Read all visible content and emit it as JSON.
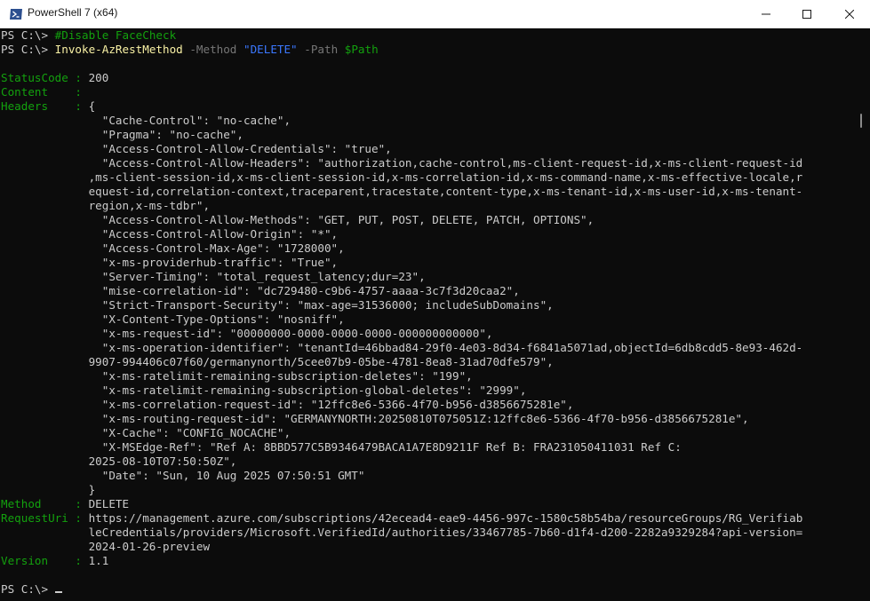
{
  "window": {
    "title": "PowerShell 7 (x64)",
    "icon": "powershell-icon",
    "controls": {
      "minimize": "minimize-icon",
      "maximize": "maximize-icon",
      "close": "close-icon"
    }
  },
  "colors": {
    "background": "#0c0c0c",
    "default_text": "#cccccc",
    "property_green": "#13a10e",
    "command_yellow": "#f9f1a5",
    "parameter_gray": "#767676",
    "string_blue": "#3b78ff"
  },
  "terminal": {
    "lines": [
      [
        {
          "t": "PS C:\\> ",
          "c": "c-def"
        },
        {
          "t": "#Disable FaceCheck",
          "c": "c-cmt"
        }
      ],
      [
        {
          "t": "PS C:\\> ",
          "c": "c-def"
        },
        {
          "t": "Invoke-AzRestMethod",
          "c": "c-cmd"
        },
        {
          "t": " -Method ",
          "c": "c-par"
        },
        {
          "t": "\"DELETE\"",
          "c": "c-str"
        },
        {
          "t": " -Path ",
          "c": "c-par"
        },
        {
          "t": "$Path",
          "c": "c-var"
        }
      ],
      [],
      [
        {
          "t": "StatusCode : ",
          "c": "c-grn"
        },
        {
          "t": "200",
          "c": "c-def"
        }
      ],
      [
        {
          "t": "Content    : ",
          "c": "c-grn"
        }
      ],
      [
        {
          "t": "Headers    : ",
          "c": "c-grn"
        },
        {
          "t": "{",
          "c": "c-def"
        }
      ],
      [
        {
          "t": "               \"Cache-Control\": \"no-cache\",",
          "c": "c-def"
        }
      ],
      [
        {
          "t": "               \"Pragma\": \"no-cache\",",
          "c": "c-def"
        }
      ],
      [
        {
          "t": "               \"Access-Control-Allow-Credentials\": \"true\",",
          "c": "c-def"
        }
      ],
      [
        {
          "t": "               \"Access-Control-Allow-Headers\": \"authorization,cache-control,ms-client-request-id,x-ms-client-request-id",
          "c": "c-def"
        }
      ],
      [
        {
          "t": "             ,ms-client-session-id,x-ms-client-session-id,x-ms-correlation-id,x-ms-command-name,x-ms-effective-locale,r",
          "c": "c-def"
        }
      ],
      [
        {
          "t": "             equest-id,correlation-context,traceparent,tracestate,content-type,x-ms-tenant-id,x-ms-user-id,x-ms-tenant-",
          "c": "c-def"
        }
      ],
      [
        {
          "t": "             region,x-ms-tdbr\",",
          "c": "c-def"
        }
      ],
      [
        {
          "t": "               \"Access-Control-Allow-Methods\": \"GET, PUT, POST, DELETE, PATCH, OPTIONS\",",
          "c": "c-def"
        }
      ],
      [
        {
          "t": "               \"Access-Control-Allow-Origin\": \"*\",",
          "c": "c-def"
        }
      ],
      [
        {
          "t": "               \"Access-Control-Max-Age\": \"1728000\",",
          "c": "c-def"
        }
      ],
      [
        {
          "t": "               \"x-ms-providerhub-traffic\": \"True\",",
          "c": "c-def"
        }
      ],
      [
        {
          "t": "               \"Server-Timing\": \"total_request_latency;dur=23\",",
          "c": "c-def"
        }
      ],
      [
        {
          "t": "               \"mise-correlation-id\": \"dc729480-c9b6-4757-aaaa-3c7f3d20caa2\",",
          "c": "c-def"
        }
      ],
      [
        {
          "t": "               \"Strict-Transport-Security\": \"max-age=31536000; includeSubDomains\",",
          "c": "c-def"
        }
      ],
      [
        {
          "t": "               \"X-Content-Type-Options\": \"nosniff\",",
          "c": "c-def"
        }
      ],
      [
        {
          "t": "               \"x-ms-request-id\": \"00000000-0000-0000-0000-000000000000\",",
          "c": "c-def"
        }
      ],
      [
        {
          "t": "               \"x-ms-operation-identifier\": \"tenantId=46bbad84-29f0-4e03-8d34-f6841a5071ad,objectId=6db8cdd5-8e93-462d-",
          "c": "c-def"
        }
      ],
      [
        {
          "t": "             9907-994406c07f60/germanynorth/5cee07b9-05be-4781-8ea8-31ad70dfe579\",",
          "c": "c-def"
        }
      ],
      [
        {
          "t": "               \"x-ms-ratelimit-remaining-subscription-deletes\": \"199\",",
          "c": "c-def"
        }
      ],
      [
        {
          "t": "               \"x-ms-ratelimit-remaining-subscription-global-deletes\": \"2999\",",
          "c": "c-def"
        }
      ],
      [
        {
          "t": "               \"x-ms-correlation-request-id\": \"12ffc8e6-5366-4f70-b956-d3856675281e\",",
          "c": "c-def"
        }
      ],
      [
        {
          "t": "               \"x-ms-routing-request-id\": \"GERMANYNORTH:20250810T075051Z:12ffc8e6-5366-4f70-b956-d3856675281e\",",
          "c": "c-def"
        }
      ],
      [
        {
          "t": "               \"X-Cache\": \"CONFIG_NOCACHE\",",
          "c": "c-def"
        }
      ],
      [
        {
          "t": "               \"X-MSEdge-Ref\": \"Ref A: 8BBD577C5B9346479BACA1A7E8D9211F Ref B: FRA231050411031 Ref C:",
          "c": "c-def"
        }
      ],
      [
        {
          "t": "             2025-08-10T07:50:50Z\",",
          "c": "c-def"
        }
      ],
      [
        {
          "t": "               \"Date\": \"Sun, 10 Aug 2025 07:50:51 GMT\"",
          "c": "c-def"
        }
      ],
      [
        {
          "t": "             }",
          "c": "c-def"
        }
      ],
      [
        {
          "t": "Method     : ",
          "c": "c-grn"
        },
        {
          "t": "DELETE",
          "c": "c-def"
        }
      ],
      [
        {
          "t": "RequestUri : ",
          "c": "c-grn"
        },
        {
          "t": "https://management.azure.com/subscriptions/42ecead4-eae9-4456-997c-1580c58b54ba/resourceGroups/RG_Verifiab",
          "c": "c-def"
        }
      ],
      [
        {
          "t": "             leCredentials/providers/Microsoft.VerifiedId/authorities/33467785-7b60-d1f4-d200-2282a9329284?api-version=",
          "c": "c-def"
        }
      ],
      [
        {
          "t": "             2024-01-26-preview",
          "c": "c-def"
        }
      ],
      [
        {
          "t": "Version    : ",
          "c": "c-grn"
        },
        {
          "t": "1.1",
          "c": "c-def"
        }
      ],
      [],
      [
        {
          "t": "PS C:\\> ",
          "c": "c-def"
        }
      ]
    ]
  }
}
